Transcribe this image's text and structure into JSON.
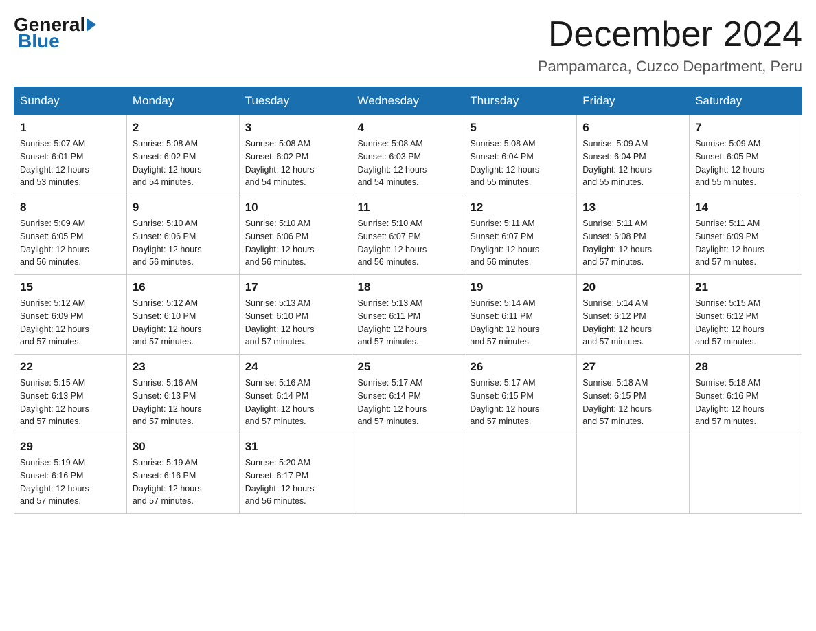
{
  "header": {
    "logo_general": "General",
    "logo_blue": "Blue",
    "month_title": "December 2024",
    "location": "Pampamarca, Cuzco Department, Peru"
  },
  "days_of_week": [
    "Sunday",
    "Monday",
    "Tuesday",
    "Wednesday",
    "Thursday",
    "Friday",
    "Saturday"
  ],
  "weeks": [
    [
      {
        "day": "1",
        "sunrise": "5:07 AM",
        "sunset": "6:01 PM",
        "daylight": "12 hours and 53 minutes."
      },
      {
        "day": "2",
        "sunrise": "5:08 AM",
        "sunset": "6:02 PM",
        "daylight": "12 hours and 54 minutes."
      },
      {
        "day": "3",
        "sunrise": "5:08 AM",
        "sunset": "6:02 PM",
        "daylight": "12 hours and 54 minutes."
      },
      {
        "day": "4",
        "sunrise": "5:08 AM",
        "sunset": "6:03 PM",
        "daylight": "12 hours and 54 minutes."
      },
      {
        "day": "5",
        "sunrise": "5:08 AM",
        "sunset": "6:04 PM",
        "daylight": "12 hours and 55 minutes."
      },
      {
        "day": "6",
        "sunrise": "5:09 AM",
        "sunset": "6:04 PM",
        "daylight": "12 hours and 55 minutes."
      },
      {
        "day": "7",
        "sunrise": "5:09 AM",
        "sunset": "6:05 PM",
        "daylight": "12 hours and 55 minutes."
      }
    ],
    [
      {
        "day": "8",
        "sunrise": "5:09 AM",
        "sunset": "6:05 PM",
        "daylight": "12 hours and 56 minutes."
      },
      {
        "day": "9",
        "sunrise": "5:10 AM",
        "sunset": "6:06 PM",
        "daylight": "12 hours and 56 minutes."
      },
      {
        "day": "10",
        "sunrise": "5:10 AM",
        "sunset": "6:06 PM",
        "daylight": "12 hours and 56 minutes."
      },
      {
        "day": "11",
        "sunrise": "5:10 AM",
        "sunset": "6:07 PM",
        "daylight": "12 hours and 56 minutes."
      },
      {
        "day": "12",
        "sunrise": "5:11 AM",
        "sunset": "6:07 PM",
        "daylight": "12 hours and 56 minutes."
      },
      {
        "day": "13",
        "sunrise": "5:11 AM",
        "sunset": "6:08 PM",
        "daylight": "12 hours and 57 minutes."
      },
      {
        "day": "14",
        "sunrise": "5:11 AM",
        "sunset": "6:09 PM",
        "daylight": "12 hours and 57 minutes."
      }
    ],
    [
      {
        "day": "15",
        "sunrise": "5:12 AM",
        "sunset": "6:09 PM",
        "daylight": "12 hours and 57 minutes."
      },
      {
        "day": "16",
        "sunrise": "5:12 AM",
        "sunset": "6:10 PM",
        "daylight": "12 hours and 57 minutes."
      },
      {
        "day": "17",
        "sunrise": "5:13 AM",
        "sunset": "6:10 PM",
        "daylight": "12 hours and 57 minutes."
      },
      {
        "day": "18",
        "sunrise": "5:13 AM",
        "sunset": "6:11 PM",
        "daylight": "12 hours and 57 minutes."
      },
      {
        "day": "19",
        "sunrise": "5:14 AM",
        "sunset": "6:11 PM",
        "daylight": "12 hours and 57 minutes."
      },
      {
        "day": "20",
        "sunrise": "5:14 AM",
        "sunset": "6:12 PM",
        "daylight": "12 hours and 57 minutes."
      },
      {
        "day": "21",
        "sunrise": "5:15 AM",
        "sunset": "6:12 PM",
        "daylight": "12 hours and 57 minutes."
      }
    ],
    [
      {
        "day": "22",
        "sunrise": "5:15 AM",
        "sunset": "6:13 PM",
        "daylight": "12 hours and 57 minutes."
      },
      {
        "day": "23",
        "sunrise": "5:16 AM",
        "sunset": "6:13 PM",
        "daylight": "12 hours and 57 minutes."
      },
      {
        "day": "24",
        "sunrise": "5:16 AM",
        "sunset": "6:14 PM",
        "daylight": "12 hours and 57 minutes."
      },
      {
        "day": "25",
        "sunrise": "5:17 AM",
        "sunset": "6:14 PM",
        "daylight": "12 hours and 57 minutes."
      },
      {
        "day": "26",
        "sunrise": "5:17 AM",
        "sunset": "6:15 PM",
        "daylight": "12 hours and 57 minutes."
      },
      {
        "day": "27",
        "sunrise": "5:18 AM",
        "sunset": "6:15 PM",
        "daylight": "12 hours and 57 minutes."
      },
      {
        "day": "28",
        "sunrise": "5:18 AM",
        "sunset": "6:16 PM",
        "daylight": "12 hours and 57 minutes."
      }
    ],
    [
      {
        "day": "29",
        "sunrise": "5:19 AM",
        "sunset": "6:16 PM",
        "daylight": "12 hours and 57 minutes."
      },
      {
        "day": "30",
        "sunrise": "5:19 AM",
        "sunset": "6:16 PM",
        "daylight": "12 hours and 57 minutes."
      },
      {
        "day": "31",
        "sunrise": "5:20 AM",
        "sunset": "6:17 PM",
        "daylight": "12 hours and 56 minutes."
      },
      null,
      null,
      null,
      null
    ]
  ],
  "labels": {
    "sunrise": "Sunrise:",
    "sunset": "Sunset:",
    "daylight": "Daylight:"
  }
}
